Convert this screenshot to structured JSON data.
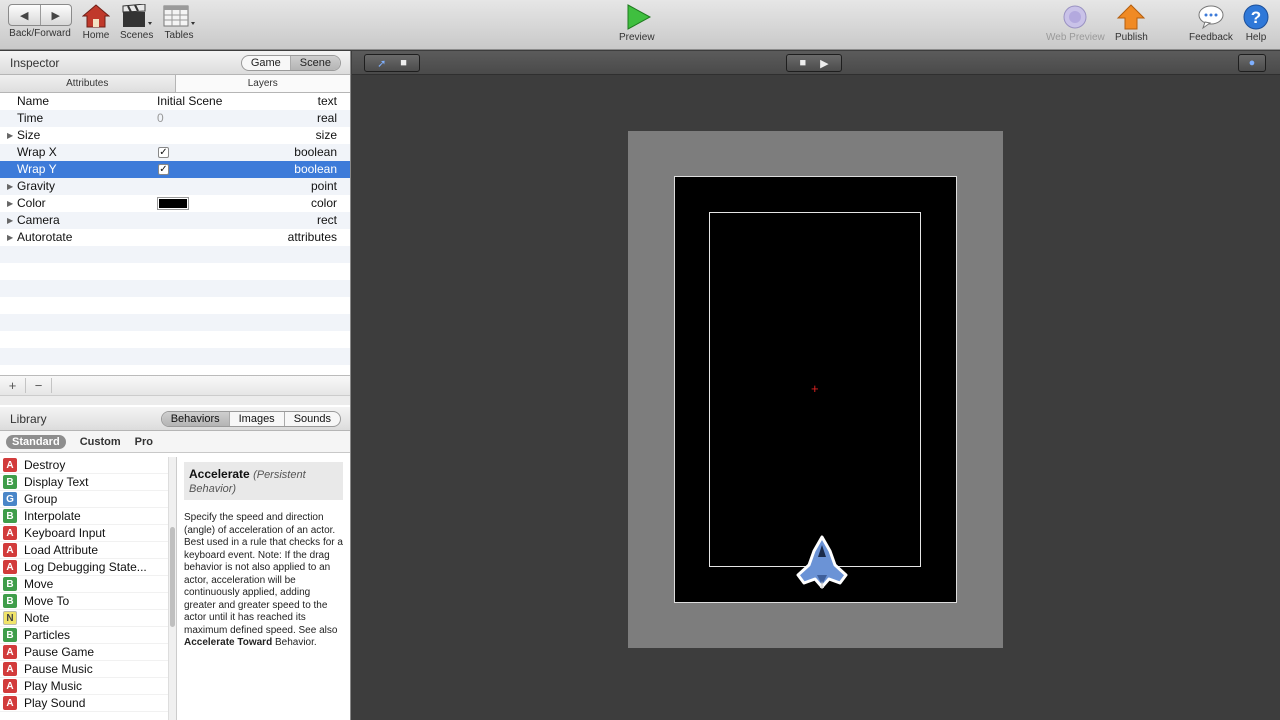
{
  "toolbar": {
    "back_forward": "Back/Forward",
    "home": "Home",
    "scenes": "Scenes",
    "tables": "Tables",
    "preview": "Preview",
    "web_preview": "Web Preview",
    "publish": "Publish",
    "feedback": "Feedback",
    "help": "Help"
  },
  "inspector": {
    "title": "Inspector",
    "toggle": [
      "Game",
      "Scene"
    ],
    "tabs": [
      "Attributes",
      "Layers"
    ],
    "attributes": [
      {
        "name": "Name",
        "value": "Initial Scene",
        "type": "text"
      },
      {
        "name": "Time",
        "value": "0",
        "type": "real"
      },
      {
        "name": "Size",
        "value": "",
        "type": "size"
      },
      {
        "name": "Wrap X",
        "value": "✓",
        "type": "boolean"
      },
      {
        "name": "Wrap Y",
        "value": "✓",
        "type": "boolean"
      },
      {
        "name": "Gravity",
        "value": "",
        "type": "point"
      },
      {
        "name": "Color",
        "value": "",
        "type": "color",
        "color": "#000000"
      },
      {
        "name": "Camera",
        "value": "",
        "type": "rect"
      },
      {
        "name": "Autorotate",
        "value": "",
        "type": "attributes"
      }
    ],
    "add": "+",
    "remove": "−"
  },
  "library": {
    "title": "Library",
    "tabs": [
      "Behaviors",
      "Images",
      "Sounds"
    ],
    "subtabs": [
      "Standard",
      "Custom",
      "Pro"
    ],
    "behaviors": [
      {
        "badge": "A",
        "label": "Destroy"
      },
      {
        "badge": "B",
        "label": "Display Text"
      },
      {
        "badge": "G",
        "label": "Group"
      },
      {
        "badge": "B",
        "label": "Interpolate"
      },
      {
        "badge": "A",
        "label": "Keyboard Input"
      },
      {
        "badge": "A",
        "label": "Load Attribute"
      },
      {
        "badge": "A",
        "label": "Log Debugging State..."
      },
      {
        "badge": "B",
        "label": "Move"
      },
      {
        "badge": "B",
        "label": "Move To"
      },
      {
        "badge": "N",
        "label": "Note"
      },
      {
        "badge": "B",
        "label": "Particles"
      },
      {
        "badge": "A",
        "label": "Pause Game"
      },
      {
        "badge": "A",
        "label": "Pause Music"
      },
      {
        "badge": "A",
        "label": "Play Music"
      },
      {
        "badge": "A",
        "label": "Play Sound"
      }
    ],
    "help": {
      "title": "Accelerate",
      "subtitle": "(Persistent Behavior)",
      "body_1": "Specify the speed and direction (angle) of acceleration of an actor. Best used in a rule that checks for a keyboard event. Note: If the drag behavior is not also applied to an actor, acceleration will be continuously applied, adding greater and greater speed to the actor until it has reached its maximum defined speed. See also ",
      "link": "Accelerate Toward",
      "body_2": " Behavior."
    }
  },
  "stage": {
    "crosshair": "+"
  },
  "colors": {
    "selection": "#3d7bd9",
    "stage_bg": "#3d3d3d",
    "ship_fill": "#6b93d6"
  }
}
